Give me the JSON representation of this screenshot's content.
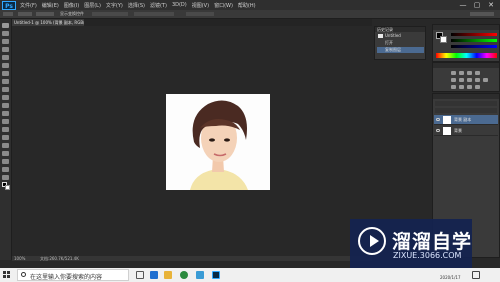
{
  "app": {
    "logo_text": "Ps"
  },
  "menu": {
    "items": [
      "文件(F)",
      "编辑(E)",
      "图像(I)",
      "图层(L)",
      "文字(Y)",
      "选择(S)",
      "滤镜(T)",
      "3D(D)",
      "视图(V)",
      "窗口(W)",
      "帮助(H)"
    ]
  },
  "window_controls": {
    "minimize": "—",
    "maximize": "▢",
    "close": "✕"
  },
  "options_bar": {
    "label": "显示变换控件"
  },
  "document": {
    "tab_label": "Untitled-1 @ 100% (背景 副本, RGB/8)"
  },
  "status_bar": {
    "zoom": "100%",
    "doc_info": "文档:260.7K/521.4K"
  },
  "history_panel": {
    "title": "历史记录",
    "rows": [
      "Untitled",
      "打开",
      "复制图层"
    ]
  },
  "layers_panel": {
    "rows": [
      "背景 副本",
      "背景"
    ],
    "selected_index": 0
  },
  "watermark": {
    "title": "溜溜自学",
    "url": "ZIXUE.3066.COM"
  },
  "taskbar": {
    "search_placeholder": "在这里输入你要搜索的内容",
    "tray_time": "",
    "tray_date": "2020/1/17"
  },
  "colors": {
    "accent": "#4b6a91",
    "brand": "#31a8ff"
  }
}
